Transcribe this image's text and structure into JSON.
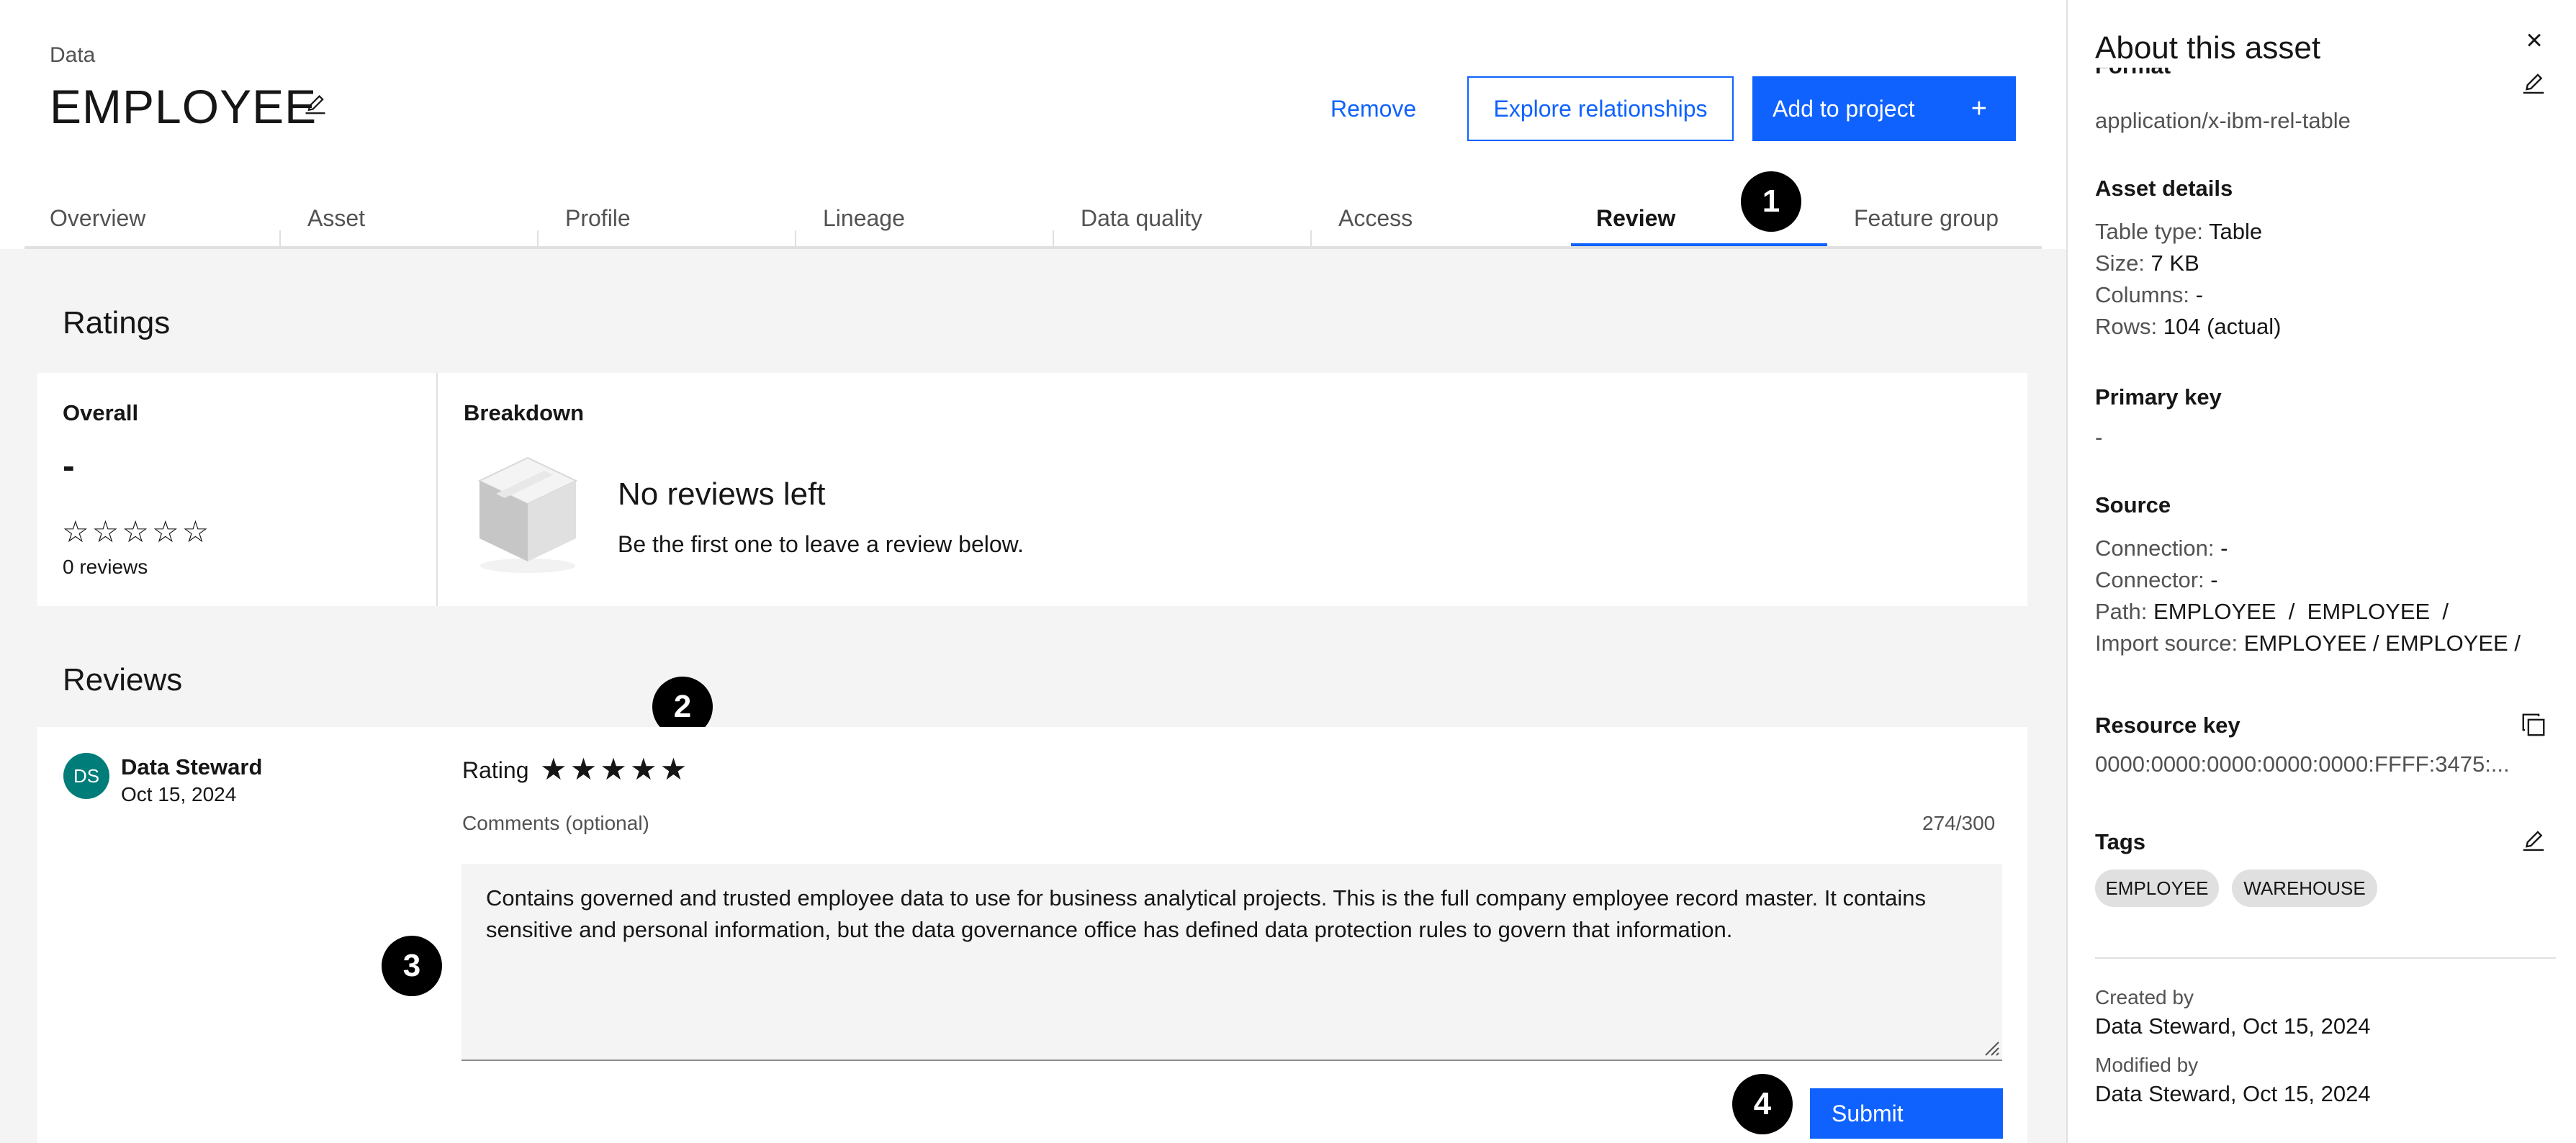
{
  "header": {
    "breadcrumb": "Data",
    "title": "EMPLOYEE",
    "remove_label": "Remove",
    "explore_label": "Explore relationships",
    "add_label": "Add to project",
    "add_icon": "+"
  },
  "tabs": [
    "Overview",
    "Asset",
    "Profile",
    "Lineage",
    "Data quality",
    "Access",
    "Review",
    "Feature group"
  ],
  "active_tab": "Review",
  "badges": [
    "1",
    "2",
    "3",
    "4"
  ],
  "ratings": {
    "heading": "Ratings",
    "overall_label": "Overall",
    "overall_value": "-",
    "stars_empty": "☆☆☆☆☆",
    "star_rating": 0,
    "reviews_count": "0 reviews",
    "breakdown_label": "Breakdown",
    "empty_title": "No reviews left",
    "empty_subtitle": "Be the first one to leave a review below."
  },
  "reviews": {
    "heading": "Reviews",
    "avatar_initials": "DS",
    "reviewer_name": "Data Steward",
    "reviewer_date": "Oct 15, 2024",
    "rating_label": "Rating",
    "stars_filled": "★★★★★",
    "selected_rating": 5,
    "comments_label": "Comments (optional)",
    "comments_count": "274/300",
    "comment_text": "Contains governed and trusted employee data to use for business analytical projects. This is the full company employee record master. It contains sensitive and personal information, but the data governance office has defined data protection rules to govern that information.",
    "submit_label": "Submit"
  },
  "side_panel": {
    "title": "About this asset",
    "close_icon": "×",
    "format_label": "Format",
    "format_value": "application/x-ibm-rel-table",
    "asset_details_label": "Asset details",
    "table_type_label": "Table type:",
    "table_type_value": "Table",
    "size_label": "Size:",
    "size_value": "7 KB",
    "columns_label": "Columns:",
    "columns_value": "-",
    "rows_label": "Rows:",
    "rows_value": "104 (actual)",
    "primary_key_label": "Primary key",
    "primary_key_value": "-",
    "source_label": "Source",
    "connection_label": "Connection:",
    "connection_value": "-",
    "connector_label": "Connector:",
    "connector_value": "-",
    "path_label": "Path:",
    "path_value": "EMPLOYEE  /  EMPLOYEE  /",
    "import_source_label": "Import source:",
    "import_source_value": "EMPLOYEE / EMPLOYEE /",
    "resource_key_label": "Resource key",
    "resource_key_value": "0000:0000:0000:0000:0000:FFFF:3475:...",
    "tags_label": "Tags",
    "tags": [
      "EMPLOYEE",
      "WAREHOUSE"
    ],
    "created_by_label": "Created by",
    "created_by_value": "Data Steward, Oct 15, 2024",
    "modified_by_label": "Modified by",
    "modified_by_value": "Data Steward, Oct 15, 2024"
  },
  "colors": {
    "accent": "#0f62fe",
    "avatar": "#007d79",
    "tag_bg": "#e0e0e0"
  }
}
